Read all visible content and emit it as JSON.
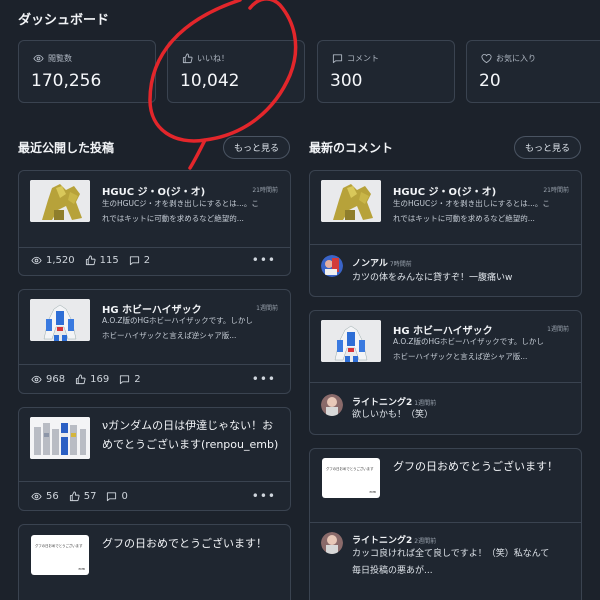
{
  "header": {
    "title": "ダッシュボード"
  },
  "stats": [
    {
      "label": "閲覧数",
      "value": "170,256",
      "icon": "eye-icon"
    },
    {
      "label": "いいね！",
      "value": "10,042",
      "icon": "thumbs-up-icon"
    },
    {
      "label": "コメント",
      "value": "300",
      "icon": "comment-icon"
    },
    {
      "label": "お気に入り",
      "value": "20",
      "icon": "heart-icon"
    }
  ],
  "recent_posts": {
    "title": "最近公開した投稿",
    "more": "もっと見る",
    "items": [
      {
        "title": "HGUC ジ・O(ジ・オ)",
        "time": "21時間前",
        "desc1": "生のHGUCジ・オを剥き出しにするとは...。こ",
        "desc2": "れではキットに可動を求めるなど絶望的...",
        "views": "1,520",
        "likes": "115",
        "comments": "2",
        "more_dots": "•••"
      },
      {
        "title": "HG ホビーハイザック",
        "time": "1週間前",
        "desc1": "A.O.Z版のHGホビーハイザックです。しかし",
        "desc2": "ホビーハイザックと言えば逆シャア版...",
        "views": "968",
        "likes": "169",
        "comments": "2",
        "more_dots": "•••"
      },
      {
        "title1": "νガンダムの日は伊達じゃない！お",
        "title2": "めでとうございます(renpou_emb)",
        "views": "56",
        "likes": "57",
        "comments": "0",
        "more_dots": "•••"
      },
      {
        "title": "グフの日おめでとうございます！",
        "thumb_text": "グフの日おめでとうございます",
        "thumb_sign": "EMB"
      }
    ]
  },
  "latest_comments": {
    "title": "最新のコメント",
    "more": "もっと見る",
    "items": [
      {
        "post_title": "HGUC ジ・O(ジ・オ)",
        "post_time": "21時間前",
        "desc1": "生のHGUCジ・オを剥き出しにするとは...。こ",
        "desc2": "れではキットに可動を求めるなど絶望的...",
        "user": "ノンアル",
        "comment_time": "7時間前",
        "comment": "カツの体をみんなに貸すぞ！一腹痛いw"
      },
      {
        "post_title": "HG ホビーハイザック",
        "post_time": "1週間前",
        "desc1": "A.O.Z版のHGホビーハイザックです。しかし",
        "desc2": "ホビーハイザックと言えば逆シャア版...",
        "user": "ライトニング2",
        "comment_time": "1週間前",
        "comment": "欲しいかも！（笑）"
      },
      {
        "post_title": "グフの日おめでとうございます！",
        "thumb_text": "グフの日おめでとうございます",
        "thumb_sign": "EMB",
        "user": "ライトニング2",
        "comment_time": "2週間前",
        "comment1": "カッコ良ければ全て良しですよ！（笑）私なんて",
        "comment2": "毎日投稿の悪あが..."
      }
    ]
  },
  "colors": {
    "background": "#1c222b",
    "card": "#1f2630",
    "border": "#3a4350",
    "annotation": "#e3262b"
  }
}
